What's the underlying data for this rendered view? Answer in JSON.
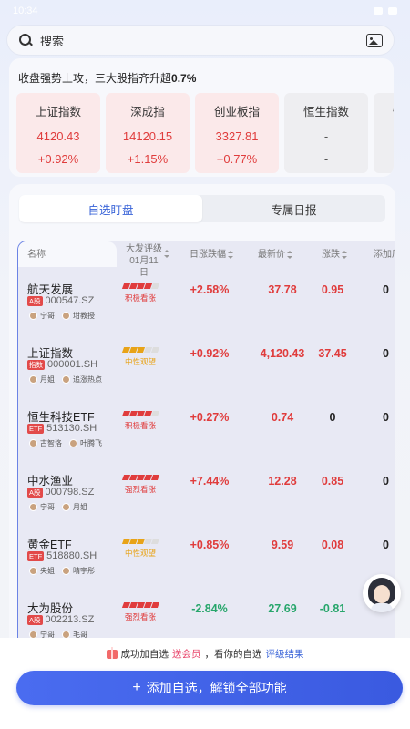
{
  "status": {
    "time": "10:34"
  },
  "search": {
    "placeholder": "搜索"
  },
  "market": {
    "headline_prefix": "收盘强势上攻，三大股指齐升超",
    "headline_value": "0.7%",
    "indices": [
      {
        "name": "上证指数",
        "value": "4120.43",
        "change": "+0.92%",
        "trend": "up"
      },
      {
        "name": "深成指",
        "value": "14120.15",
        "change": "+1.15%",
        "trend": "up"
      },
      {
        "name": "创业板指",
        "value": "3327.81",
        "change": "+0.77%",
        "trend": "up"
      },
      {
        "name": "恒生指数",
        "value": "-",
        "change": "-",
        "trend": "flat"
      },
      {
        "name": "恒生科技",
        "value": "-",
        "change": "-",
        "trend": "flat"
      }
    ]
  },
  "tabs": [
    {
      "label": "自选盯盘",
      "active": true
    },
    {
      "label": "专属日报",
      "active": false
    }
  ],
  "table": {
    "headers": {
      "name": "名称",
      "rating": "大发评级",
      "rating_date": "01月11日",
      "chg_pct": "日涨跌幅",
      "price": "最新价",
      "chg": "涨跌",
      "added": "添加后"
    },
    "rows": [
      {
        "name": "航天发展",
        "market": "A股",
        "code": "000547.SZ",
        "people": [
          "宁哥",
          "坩教授"
        ],
        "rating_level": 4,
        "rating": "积极看涨",
        "rating_color": "#e03c3c",
        "chg_pct": "+2.58%",
        "price": "37.78",
        "chg": "0.95",
        "color": "red",
        "extra": "0"
      },
      {
        "name": "上证指数",
        "market": "指数",
        "code": "000001.SH",
        "people": [
          "月姐",
          "追涨热点"
        ],
        "rating_level": 3,
        "rating": "中性观望",
        "rating_color": "#e8a317",
        "chg_pct": "+0.92%",
        "price": "4,120.43",
        "chg": "37.45",
        "color": "red",
        "extra": "0"
      },
      {
        "name": "恒生科技ETF",
        "market": "ETF",
        "code": "513130.SH",
        "people": [
          "古智洛",
          "叶腾飞"
        ],
        "rating_level": 4,
        "rating": "积极看涨",
        "rating_color": "#e03c3c",
        "chg_pct": "+0.27%",
        "price": "0.74",
        "chg": "0",
        "color": "red",
        "chg_color": "dark",
        "extra": "0"
      },
      {
        "name": "中水渔业",
        "market": "A股",
        "code": "000798.SZ",
        "people": [
          "宁哥",
          "月姐"
        ],
        "rating_level": 5,
        "rating": "强烈看涨",
        "rating_color": "#e03c3c",
        "chg_pct": "+7.44%",
        "price": "12.28",
        "chg": "0.85",
        "color": "red",
        "extra": "0"
      },
      {
        "name": "黄金ETF",
        "market": "ETF",
        "code": "518880.SH",
        "people": [
          "央姐",
          "晴宇彤"
        ],
        "rating_level": 3,
        "rating": "中性观望",
        "rating_color": "#e8a317",
        "chg_pct": "+0.85%",
        "price": "9.59",
        "chg": "0.08",
        "color": "red",
        "extra": "0"
      },
      {
        "name": "大为股份",
        "market": "A股",
        "code": "002213.SZ",
        "people": [
          "宁哥",
          "毛哥"
        ],
        "rating_level": 5,
        "rating": "强烈看涨",
        "rating_color": "#e03c3c",
        "chg_pct": "-2.84%",
        "price": "27.69",
        "chg": "-0.81",
        "color": "green",
        "extra": ""
      }
    ]
  },
  "promo": {
    "part1": "成功加自选",
    "highlight1": "送会员",
    "part2": "，看你的自选",
    "link": "评级结果"
  },
  "cta": {
    "label": "添加自选，解锁全部功能"
  }
}
